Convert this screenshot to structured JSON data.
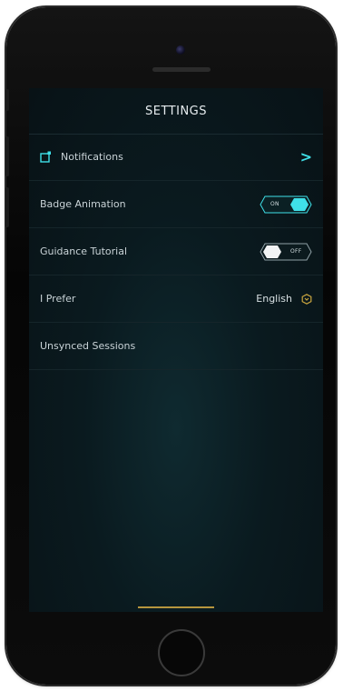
{
  "header": {
    "title": "SETTINGS"
  },
  "rows": {
    "notifications": {
      "label": "Notifications",
      "icon": "notification-square-icon",
      "chevron": ">"
    },
    "badge_animation": {
      "label": "Badge Animation",
      "toggle_state": "on",
      "toggle_text": "ON"
    },
    "guidance_tutorial": {
      "label": "Guidance Tutorial",
      "toggle_state": "off",
      "toggle_text": "OFF"
    },
    "prefer": {
      "label": "I Prefer",
      "value": "English",
      "icon": "hexagon-dropdown-icon"
    },
    "unsynced": {
      "label": "Unsynced Sessions"
    }
  },
  "colors": {
    "accent": "#3fe0e8",
    "gold": "#c9a53f",
    "background": "#0a1a1f"
  }
}
